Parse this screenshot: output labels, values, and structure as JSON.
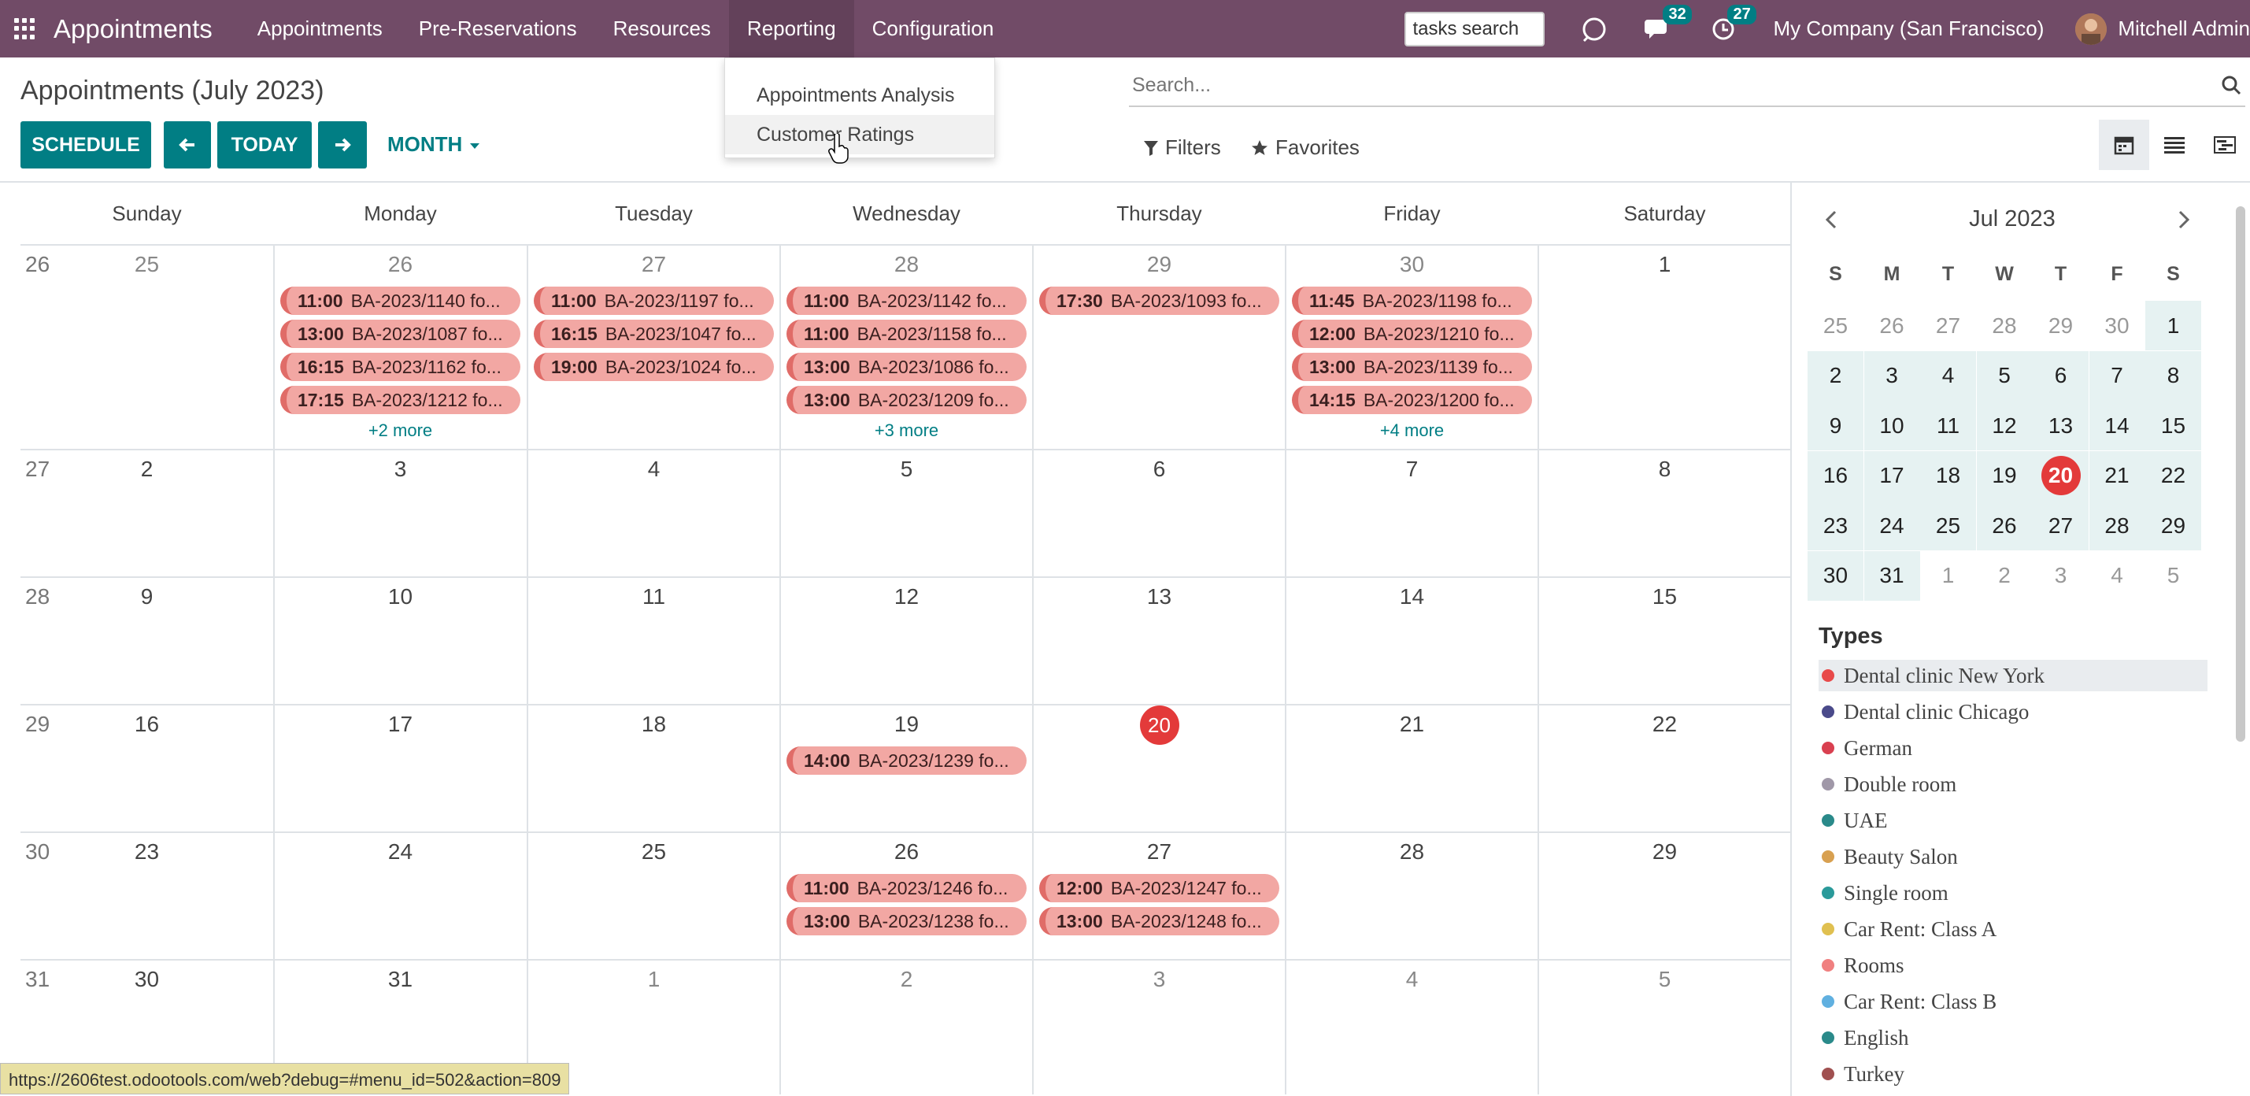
{
  "navbar": {
    "brand": "Appointments",
    "menu": [
      "Appointments",
      "Pre-Reservations",
      "Resources",
      "Reporting",
      "Configuration"
    ],
    "tasks_search": "tasks search",
    "messages_count": "32",
    "activities_count": "27",
    "company": "My Company (San Francisco)",
    "user": "Mitchell Admin"
  },
  "dropdown": {
    "items": [
      "Appointments Analysis",
      "Customer Ratings"
    ]
  },
  "control": {
    "title": "Appointments (July 2023)",
    "schedule": "SCHEDULE",
    "today": "TODAY",
    "scale": "MONTH",
    "search_placeholder": "Search...",
    "filters": "Filters",
    "favorites": "Favorites"
  },
  "calendar": {
    "weekdays": [
      "Sunday",
      "Monday",
      "Tuesday",
      "Wednesday",
      "Thursday",
      "Friday",
      "Saturday"
    ],
    "weeks": [
      {
        "num": "26",
        "days": [
          "25",
          "26",
          "27",
          "28",
          "29",
          "30",
          "1"
        ]
      },
      {
        "num": "27",
        "days": [
          "2",
          "3",
          "4",
          "5",
          "6",
          "7",
          "8"
        ]
      },
      {
        "num": "28",
        "days": [
          "9",
          "10",
          "11",
          "12",
          "13",
          "14",
          "15"
        ]
      },
      {
        "num": "29",
        "days": [
          "16",
          "17",
          "18",
          "19",
          "20",
          "21",
          "22"
        ]
      },
      {
        "num": "30",
        "days": [
          "23",
          "24",
          "25",
          "26",
          "27",
          "28",
          "29"
        ]
      },
      {
        "num": "31",
        "days": [
          "30",
          "31",
          "1",
          "2",
          "3",
          "4",
          "5"
        ]
      }
    ],
    "events": {
      "w0d1": [
        [
          "11:00",
          "BA-2023/1140 fo..."
        ],
        [
          "13:00",
          "BA-2023/1087 fo..."
        ],
        [
          "16:15",
          "BA-2023/1162 fo..."
        ],
        [
          "17:15",
          "BA-2023/1212 fo..."
        ]
      ],
      "w0d2": [
        [
          "11:00",
          "BA-2023/1197 fo..."
        ],
        [
          "16:15",
          "BA-2023/1047 fo..."
        ],
        [
          "19:00",
          "BA-2023/1024 fo..."
        ]
      ],
      "w0d3": [
        [
          "11:00",
          "BA-2023/1142 fo..."
        ],
        [
          "11:00",
          "BA-2023/1158 fo..."
        ],
        [
          "13:00",
          "BA-2023/1086 fo..."
        ],
        [
          "13:00",
          "BA-2023/1209 fo..."
        ]
      ],
      "w0d4": [
        [
          "17:30",
          "BA-2023/1093 fo..."
        ]
      ],
      "w0d5": [
        [
          "11:45",
          "BA-2023/1198 fo..."
        ],
        [
          "12:00",
          "BA-2023/1210 fo..."
        ],
        [
          "13:00",
          "BA-2023/1139 fo..."
        ],
        [
          "14:15",
          "BA-2023/1200 fo..."
        ]
      ],
      "w3d3": [
        [
          "14:00",
          "BA-2023/1239 fo..."
        ]
      ],
      "w4d3": [
        [
          "11:00",
          "BA-2023/1246 fo..."
        ],
        [
          "13:00",
          "BA-2023/1238 fo..."
        ]
      ],
      "w4d4": [
        [
          "12:00",
          "BA-2023/1247 fo..."
        ],
        [
          "13:00",
          "BA-2023/1248 fo..."
        ]
      ]
    },
    "more": {
      "w0d1": "+2 more",
      "w0d3": "+3 more",
      "w0d5": "+4 more"
    }
  },
  "mini_calendar": {
    "title": "Jul 2023",
    "dow": [
      "S",
      "M",
      "T",
      "W",
      "T",
      "F",
      "S"
    ],
    "rows": [
      [
        "25",
        "26",
        "27",
        "28",
        "29",
        "30",
        "1"
      ],
      [
        "2",
        "3",
        "4",
        "5",
        "6",
        "7",
        "8"
      ],
      [
        "9",
        "10",
        "11",
        "12",
        "13",
        "14",
        "15"
      ],
      [
        "16",
        "17",
        "18",
        "19",
        "20",
        "21",
        "22"
      ],
      [
        "23",
        "24",
        "25",
        "26",
        "27",
        "28",
        "29"
      ],
      [
        "30",
        "31",
        "1",
        "2",
        "3",
        "4",
        "5"
      ]
    ],
    "today": "20"
  },
  "types": {
    "title": "Types",
    "items": [
      {
        "label": "Dental clinic New York",
        "color": "#E84A4A"
      },
      {
        "label": "Dental clinic Chicago",
        "color": "#4A4A8A"
      },
      {
        "label": "German",
        "color": "#D94050"
      },
      {
        "label": "Double room",
        "color": "#A098A8"
      },
      {
        "label": "UAE",
        "color": "#2A8A8A"
      },
      {
        "label": "Beauty Salon",
        "color": "#D8A050"
      },
      {
        "label": "Single room",
        "color": "#2A9A9A"
      },
      {
        "label": "Car Rent: Class A",
        "color": "#E0C050"
      },
      {
        "label": "Rooms",
        "color": "#F08080"
      },
      {
        "label": "Car Rent: Class B",
        "color": "#60B0E0"
      },
      {
        "label": "English",
        "color": "#2A8A8A"
      },
      {
        "label": "Turkey",
        "color": "#A05050"
      }
    ]
  },
  "status_url": "https://2606test.odootools.com/web?debug=#menu_id=502&action=809"
}
